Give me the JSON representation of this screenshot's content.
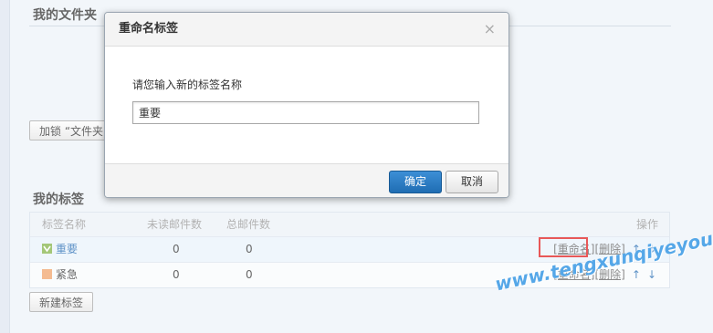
{
  "folders_section": {
    "title": "我的文件夹",
    "lock_button": "加锁 “文件夹"
  },
  "tags_section": {
    "title": "我的标签",
    "columns": {
      "name": "标签名称",
      "unread": "未读邮件数",
      "total": "总邮件数",
      "ops": "操作"
    },
    "rows": [
      {
        "name": "重要",
        "unread": "0",
        "total": "0",
        "color": "#86b44b",
        "icon": "tag-check-icon"
      },
      {
        "name": "紧急",
        "unread": "0",
        "total": "0",
        "color": "#f0a46c",
        "icon": "tag-square-icon"
      }
    ],
    "actions": {
      "rename": "[重命名]",
      "delete": "[删除]",
      "up": "↑",
      "down": "↓"
    },
    "new_tag_button": "新建标签"
  },
  "dialog": {
    "title": "重命名标签",
    "close": "×",
    "prompt": "请您输入新的标签名称",
    "input_value": "重要",
    "ok": "确定",
    "cancel": "取消"
  },
  "watermark": "www.tengxunqiyeyou.com"
}
